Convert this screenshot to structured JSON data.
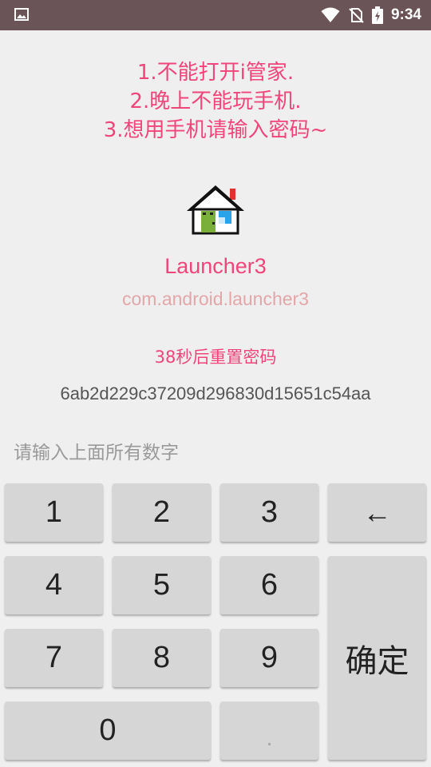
{
  "status_bar": {
    "time": "9:34",
    "icons": [
      "gallery-icon",
      "wifi-icon",
      "no-sim-icon",
      "battery-charging-icon"
    ]
  },
  "notice": {
    "line1": "1.不能打开i管家.",
    "line2": "2.晚上不能玩手机.",
    "line3": "3.想用手机请输入密码~"
  },
  "app": {
    "name": "Launcher3",
    "package": "com.android.launcher3",
    "icon": "launcher-house-icon"
  },
  "timer_text": "38秒后重置密码",
  "code": "6ab2d229c37209d296830d15651c54aa",
  "input_hint": "请输入上面所有数字",
  "keypad": {
    "k1": "1",
    "k2": "2",
    "k3": "3",
    "backspace": "←",
    "k4": "4",
    "k5": "5",
    "k6": "6",
    "k7": "7",
    "k8": "8",
    "k9": "9",
    "k0": "0",
    "dot": ".",
    "confirm": "确定"
  },
  "colors": {
    "accent": "#f0457b",
    "package_text": "#e3a6a9",
    "status_bar": "#6b5457",
    "key_bg": "#d6d6d6",
    "background": "#efefef"
  }
}
